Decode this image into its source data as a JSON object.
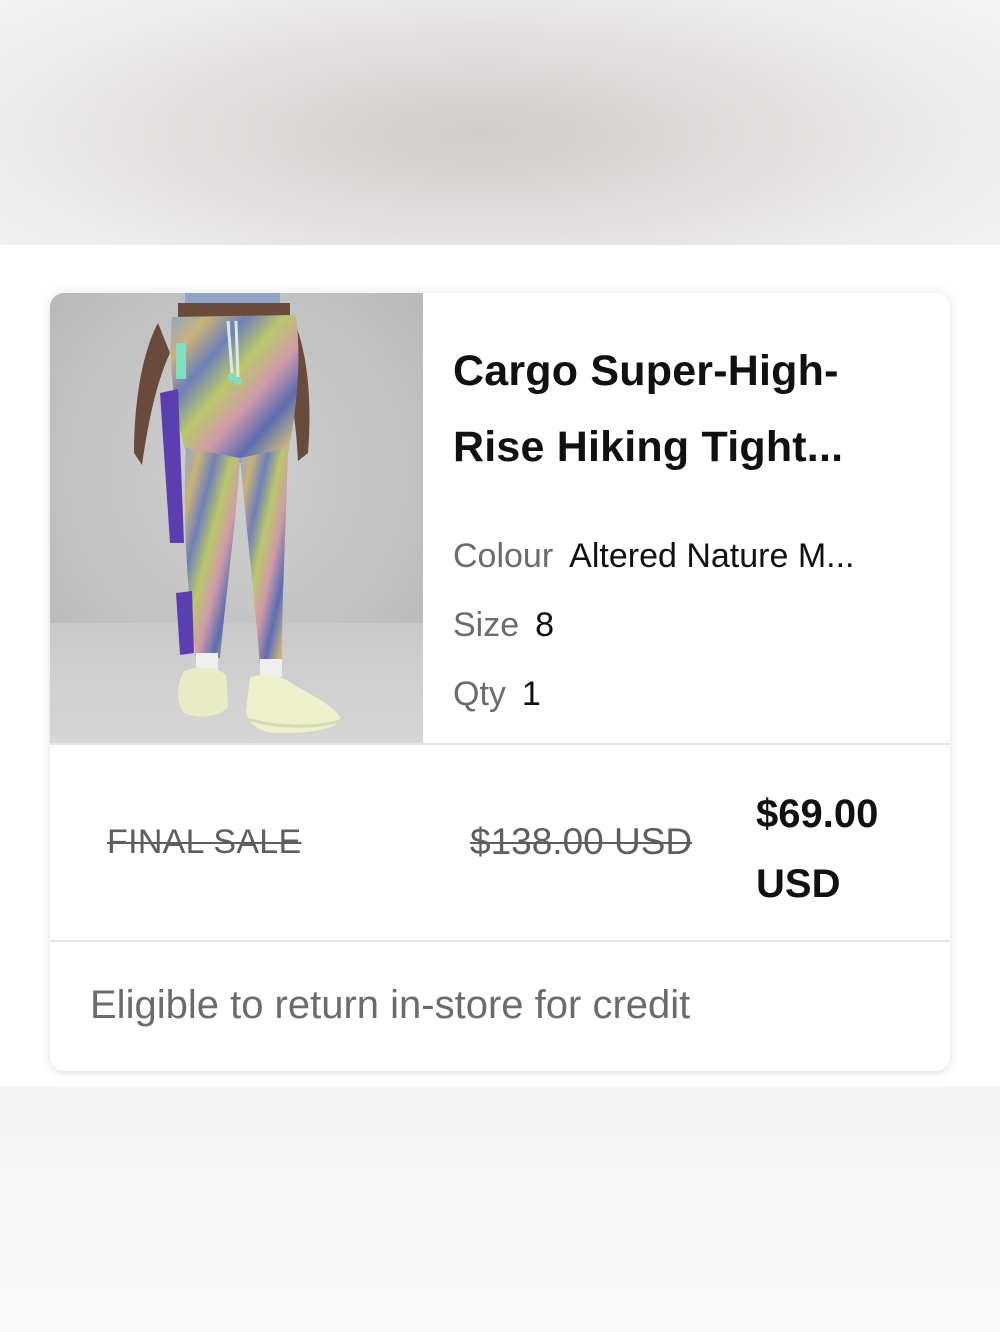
{
  "product": {
    "image_alt": "Person wearing colourful print hiking tights and pale yellow sneakers",
    "title_line1": "Cargo Super-High-",
    "title_line2": "Rise Hiking Tight...",
    "colour_label": "Colour",
    "colour_value": "Altered Nature M...",
    "size_label": "Size",
    "size_value": "8",
    "qty_label": "Qty",
    "qty_value": "1"
  },
  "pricing": {
    "final_sale": "FINAL SALE",
    "original_price": "$138.00 USD",
    "sale_price_amount": "$69.00",
    "sale_price_currency": "USD"
  },
  "returns": {
    "note": "Eligible to return in-store for credit"
  },
  "colors": {
    "card_bg": "#ffffff",
    "muted_text": "#6b6b6b",
    "strike_text": "#5e5e5e",
    "primary_text": "#111111",
    "divider": "#e3e3e3"
  }
}
